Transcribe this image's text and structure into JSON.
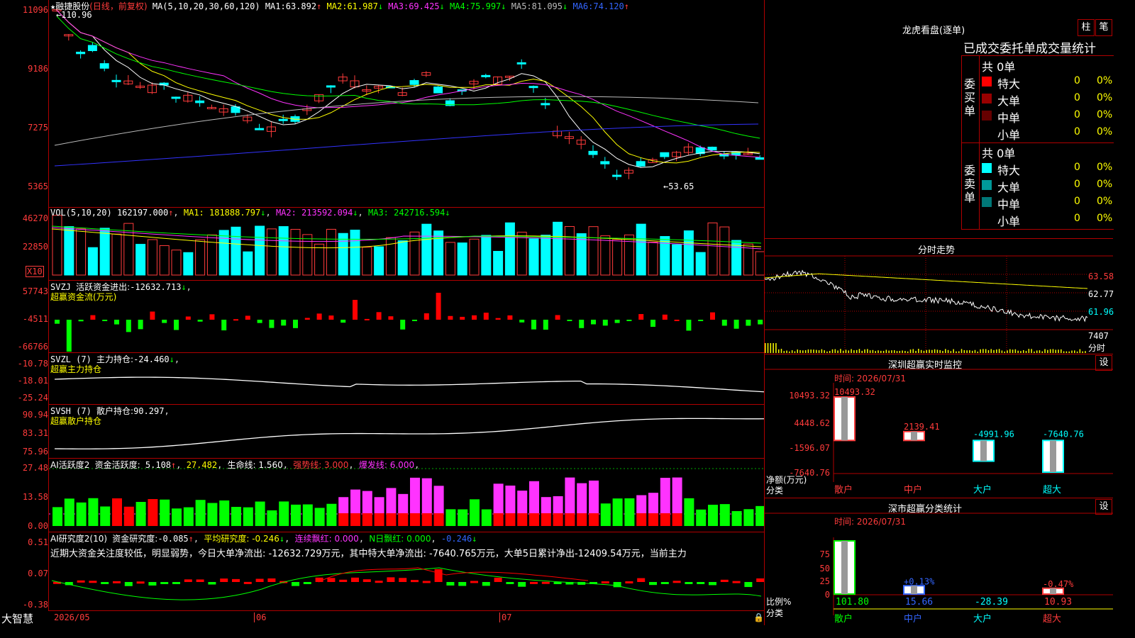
{
  "stock": {
    "star": "★",
    "name": "融捷股份",
    "mode": "(日线，前复权)"
  },
  "price_panel": {
    "ma_label": "MA(5,10,20,30,60,120)",
    "ma": [
      {
        "name": "MA1:",
        "value": "63.892",
        "trend": "↑",
        "color": "#ffffff"
      },
      {
        "name": "MA2:",
        "value": "61.987",
        "trend": "↓",
        "color": "#ffff00"
      },
      {
        "name": "MA3:",
        "value": "69.425",
        "trend": "↓",
        "color": "#ff33ff"
      },
      {
        "name": "MA4:",
        "value": "75.997",
        "trend": "↓",
        "color": "#00ff00"
      },
      {
        "name": "MA5:",
        "value": "81.095",
        "trend": "↓",
        "color": "#c0c0c0"
      },
      {
        "name": "MA6:",
        "value": "74.120",
        "trend": "↑",
        "color": "#3366ff"
      }
    ],
    "y_ticks": [
      "11096",
      "9186",
      "7275",
      "5365"
    ],
    "high_mark": "←110.96",
    "low_mark": "←53.65"
  },
  "vol_panel": {
    "label": "VOL(5,10,20)",
    "value": "162197.000",
    "ma1": "MA1: 181888.797",
    "ma2": "MA2: 213592.094",
    "ma3": "MA3: 242716.594",
    "y_ticks": [
      "46270",
      "22850"
    ],
    "unit": "X10"
  },
  "svzj": {
    "label": "SVZJ",
    "name": "活跃资金进出:",
    "value": "-12632.713",
    "title": "超赢资金流(万元)",
    "y_ticks": [
      "57743",
      "-4511",
      "-66766"
    ]
  },
  "svzl": {
    "label": "SVZL (7)",
    "name": "主力持仓:",
    "value": "-24.460",
    "title": "超赢主力持仓",
    "y_ticks": [
      "-10.78",
      "-18.01",
      "-25.24"
    ]
  },
  "svsh": {
    "label": "SVSH (7)",
    "name": "散户持仓:",
    "value": "90.297",
    "title": "超赢散户持仓",
    "y_ticks": [
      "90.94",
      "83.31",
      "75.96"
    ]
  },
  "ai_act": {
    "label": "AI活跃度2",
    "name": "资金活跃度:",
    "v1": "5.108",
    "v2": "27.482",
    "life": "生命线: 1.560",
    "strong": "强势线: 3.000",
    "burst": "爆发线: 6.000",
    "y_ticks": [
      "27.48",
      "13.58",
      "0.00"
    ]
  },
  "ai_res": {
    "label": "AI研究度2(10)",
    "name": "资金研究度:",
    "v1": "-0.085",
    "avg": "平均研究度: -0.246",
    "red": "连续飘红: 0.000",
    "nred": "N日飘红: 0.000",
    "last": "-0.246",
    "y_ticks": [
      "0.51",
      "0.07",
      "-0.38"
    ],
    "commentary": "近期大资金关注度较低，明显弱势，今日大单净流出: -12632.729万元，其中特大单净流出: -7640.765万元，大单5日累计净出-12409.54万元，当前主力"
  },
  "footer": {
    "brand": "大智慧",
    "dates": [
      "2026/05",
      "06",
      "07"
    ]
  },
  "dragon": {
    "title": "龙虎看盘(逐单)",
    "btn1": "柱",
    "btn2": "笔",
    "subtitle": "已成交委托单成交量统计",
    "buy_label": "委买单",
    "sell_label": "委卖单",
    "buy_total": "共 0单",
    "sell_total": "共 0单",
    "buy_rows": [
      {
        "name": "特大",
        "count": "0",
        "pct": "0%",
        "color": "#ff0000"
      },
      {
        "name": "大单",
        "count": "0",
        "pct": "0%",
        "color": "#990000"
      },
      {
        "name": "中单",
        "count": "0",
        "pct": "0%",
        "color": "#660000"
      },
      {
        "name": "小单",
        "count": "0",
        "pct": "0%",
        "color": "#000000"
      }
    ],
    "sell_rows": [
      {
        "name": "特大",
        "count": "0",
        "pct": "0%",
        "color": "#00ffff"
      },
      {
        "name": "大单",
        "count": "0",
        "pct": "0%",
        "color": "#009999"
      },
      {
        "name": "中单",
        "count": "0",
        "pct": "0%",
        "color": "#007777"
      },
      {
        "name": "小单",
        "count": "0",
        "pct": "0%",
        "color": "#000000"
      }
    ]
  },
  "intraday": {
    "title": "分时走势",
    "y_ticks": [
      "63.58",
      "62.77",
      "61.96"
    ],
    "vol_tick": "7407",
    "vol_label": "分时"
  },
  "sz_monitor": {
    "title": "深圳超赢实时监控",
    "btn": "设",
    "time": "时间: 2026/07/31",
    "y_ticks": [
      "10493.32",
      "4448.62",
      "-1596.07",
      "-7640.76"
    ],
    "ylabel": "净额(万元)",
    "xlabel": "分类",
    "chart_data": {
      "type": "bar",
      "categories": [
        "散户",
        "中户",
        "大户",
        "超大"
      ],
      "values": [
        10493.32,
        2139.41,
        -4991.96,
        -7640.76
      ],
      "ylim": [
        -7640.76,
        10493.32
      ]
    },
    "value_labels": [
      "10493.32",
      "2139.41",
      "-4991.96",
      "-7640.76"
    ]
  },
  "sz_class": {
    "title": "深市超赢分类统计",
    "btn": "设",
    "time": "时间: 2026/07/31",
    "y_ticks": [
      "75",
      "50",
      "25",
      "0"
    ],
    "ylabel": "比例%",
    "xlabel": "分类",
    "chart_data": {
      "type": "bar",
      "categories": [
        "散户",
        "中户",
        "大户",
        "超大"
      ],
      "values": [
        101.8,
        15.66,
        -28.39,
        10.93
      ],
      "ylim": [
        0,
        100
      ]
    },
    "pct_labels": [
      "",
      "+0.13%",
      "",
      "-0.47%"
    ],
    "value_labels": [
      "101.80",
      "15.66",
      "-28.39",
      "10.93"
    ]
  }
}
